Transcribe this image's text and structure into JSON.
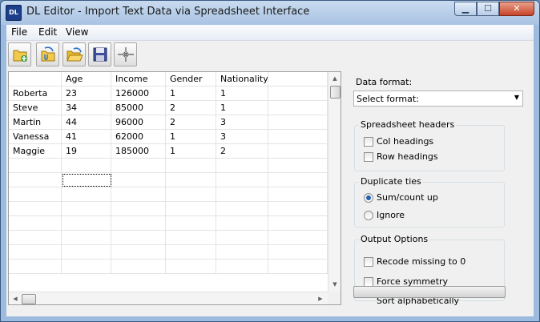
{
  "window": {
    "title": "DL Editor - Import Text Data via Spreadsheet Interface",
    "icon_text": "DL",
    "min_glyph": "▁",
    "max_glyph": "☐",
    "close_glyph": "✕"
  },
  "menu": [
    "File",
    "Edit",
    "View"
  ],
  "toolbar": [
    "new-file-icon",
    "import-icon",
    "open-folder-icon",
    "save-icon",
    "merge-icon"
  ],
  "table": {
    "headers": [
      "",
      "Age",
      "Income",
      "Gender",
      "Nationality",
      ""
    ],
    "rows": [
      [
        "Roberta",
        "23",
        "126000",
        "1",
        "1",
        ""
      ],
      [
        "Steve",
        "34",
        "85000",
        "2",
        "1",
        ""
      ],
      [
        "Martin",
        "44",
        "96000",
        "2",
        "3",
        ""
      ],
      [
        "Vanessa",
        "41",
        "62000",
        "1",
        "3",
        ""
      ],
      [
        "Maggie",
        "19",
        "185000",
        "1",
        "2",
        ""
      ]
    ]
  },
  "right_panel": {
    "data_format_label": "Data format:",
    "format_select": {
      "value": "Select format:",
      "arrow": "▼"
    },
    "spreadsheet_headers": {
      "title": "Spreadsheet headers",
      "col_label": "Col headings",
      "row_label": "Row headings",
      "col_checked": false,
      "row_checked": false
    },
    "duplicate_ties": {
      "title": "Duplicate ties",
      "option1": "Sum/count up",
      "option2": "Ignore",
      "selected": "Sum/count up"
    },
    "output_options": {
      "title": "Output Options",
      "recode_label": "Recode missing to 0",
      "symmetry_label": "Force symmetry",
      "sort_label": "Sort alphabetically"
    }
  },
  "scroll": {
    "up": "▲",
    "down": "▼",
    "left": "◀",
    "right": "▶"
  },
  "colors": {
    "title_bar": "#a9c3e3",
    "close_button": "#c8442a",
    "radio_dot": "#2460b0"
  }
}
